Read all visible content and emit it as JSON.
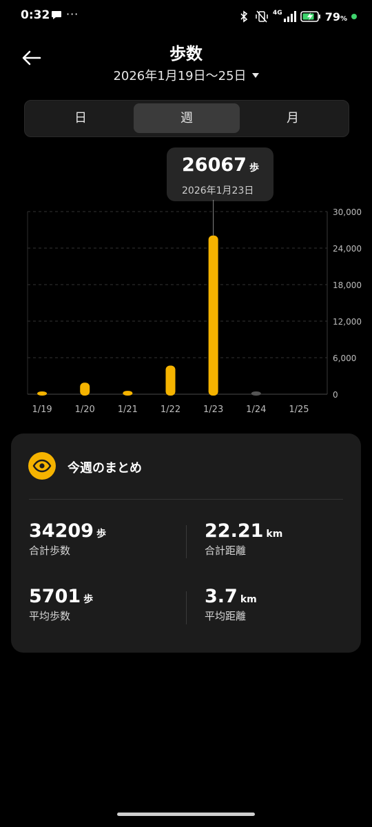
{
  "status_bar": {
    "time": "0:32",
    "dots": "···",
    "network": "4G",
    "battery_pct": "79",
    "icons": [
      "message-icon",
      "bluetooth-icon",
      "vibrate-off-icon",
      "signal-icon",
      "battery-charging-icon"
    ]
  },
  "header": {
    "title": "歩数",
    "date_range": "2026年1月19日〜25日"
  },
  "tabs": [
    {
      "label": "日",
      "selected": false
    },
    {
      "label": "週",
      "selected": true
    },
    {
      "label": "月",
      "selected": false
    }
  ],
  "tooltip": {
    "value": "26067",
    "unit": "歩",
    "date": "2026年1月23日"
  },
  "chart_data": {
    "type": "bar",
    "categories": [
      "1/19",
      "1/20",
      "1/21",
      "1/22",
      "1/23",
      "1/24",
      "1/25"
    ],
    "values": [
      400,
      1900,
      550,
      4700,
      26067,
      80,
      0
    ],
    "ylim": [
      0,
      30000
    ],
    "yticks": [
      "0",
      "6,000",
      "12,000",
      "18,000",
      "24,000",
      "30,000"
    ],
    "ytick_values": [
      0,
      6000,
      12000,
      18000,
      24000,
      30000
    ],
    "selected_index": 4,
    "bar_color": "#f5b300",
    "grid": true,
    "y_axis_side": "right"
  },
  "summary": {
    "title": "今週のまとめ",
    "icon": "eye-icon",
    "accent_color": "#f5b300",
    "total_steps": {
      "value": "34209",
      "unit": "歩",
      "label": "合計歩数"
    },
    "total_distance": {
      "value": "22.21",
      "unit": "km",
      "label": "合計距離"
    },
    "avg_steps": {
      "value": "5701",
      "unit": "歩",
      "label": "平均歩数"
    },
    "avg_distance": {
      "value": "3.7",
      "unit": "km",
      "label": "平均距離"
    }
  }
}
